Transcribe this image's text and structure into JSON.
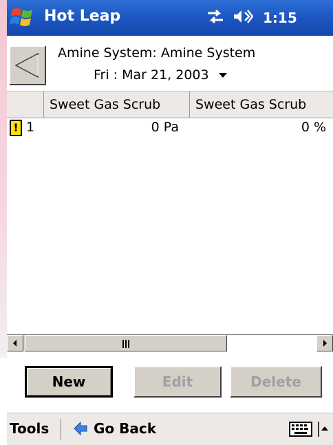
{
  "titlebar": {
    "app_title": "Hot Leap",
    "time": "1:15",
    "icons": [
      "windows-start-icon",
      "connectivity-icon",
      "speaker-icon"
    ]
  },
  "header": {
    "system_title": "Amine System: Amine System",
    "date": "Fri : Mar 21, 2003"
  },
  "table": {
    "columns": [
      "",
      "Sweet Gas Scrub",
      "Sweet Gas Scrub"
    ],
    "rows": [
      {
        "index": "1",
        "value1": "0 Pa",
        "value2": "0 %",
        "status": "warning"
      }
    ]
  },
  "scrollbar": {
    "grip": "III"
  },
  "buttons": {
    "new": "New",
    "edit": "Edit",
    "delete": "Delete"
  },
  "menubar": {
    "tools": "Tools",
    "go_back": "Go Back"
  },
  "colors": {
    "titlebar": "#1c56c2",
    "chrome": "#d4d0c8",
    "warning": "#ffe400"
  }
}
